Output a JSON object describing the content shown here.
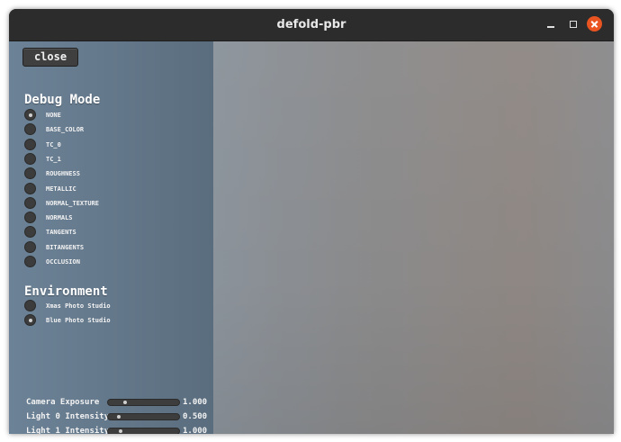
{
  "window": {
    "title": "defold-pbr",
    "controls": {
      "minimize_icon": "minimize-icon",
      "maximize_icon": "maximize-icon",
      "close_icon": "close-icon",
      "close_color": "#e95420"
    }
  },
  "panel": {
    "close_button": "close",
    "debug_mode": {
      "heading": "Debug Mode",
      "options": [
        {
          "label": "NONE",
          "selected": true
        },
        {
          "label": "BASE_COLOR",
          "selected": false
        },
        {
          "label": "TC_0",
          "selected": false
        },
        {
          "label": "TC_1",
          "selected": false
        },
        {
          "label": "ROUGHNESS",
          "selected": false
        },
        {
          "label": "METALLIC",
          "selected": false
        },
        {
          "label": "NORMAL_TEXTURE",
          "selected": false
        },
        {
          "label": "NORMALS",
          "selected": false
        },
        {
          "label": "TANGENTS",
          "selected": false
        },
        {
          "label": "BITANGENTS",
          "selected": false
        },
        {
          "label": "OCCLUSION",
          "selected": false
        }
      ]
    },
    "environment": {
      "heading": "Environment",
      "options": [
        {
          "label": "Xmas Photo Studio",
          "selected": false
        },
        {
          "label": "Blue Photo Studio",
          "selected": true
        }
      ]
    },
    "sliders": [
      {
        "label": "Camera Exposure",
        "value": "1.000",
        "fraction": 0.15
      },
      {
        "label": "Light 0 Intensity",
        "value": "0.500",
        "fraction": 0.05
      },
      {
        "label": "Light 1 Intensity",
        "value": "1.000",
        "fraction": 0.08
      }
    ]
  },
  "colors": {
    "panel": "#64788b",
    "viewport_left": "#8ea7c0",
    "viewport_right": "#8e8783",
    "titlebar": "#2c2c2c"
  }
}
